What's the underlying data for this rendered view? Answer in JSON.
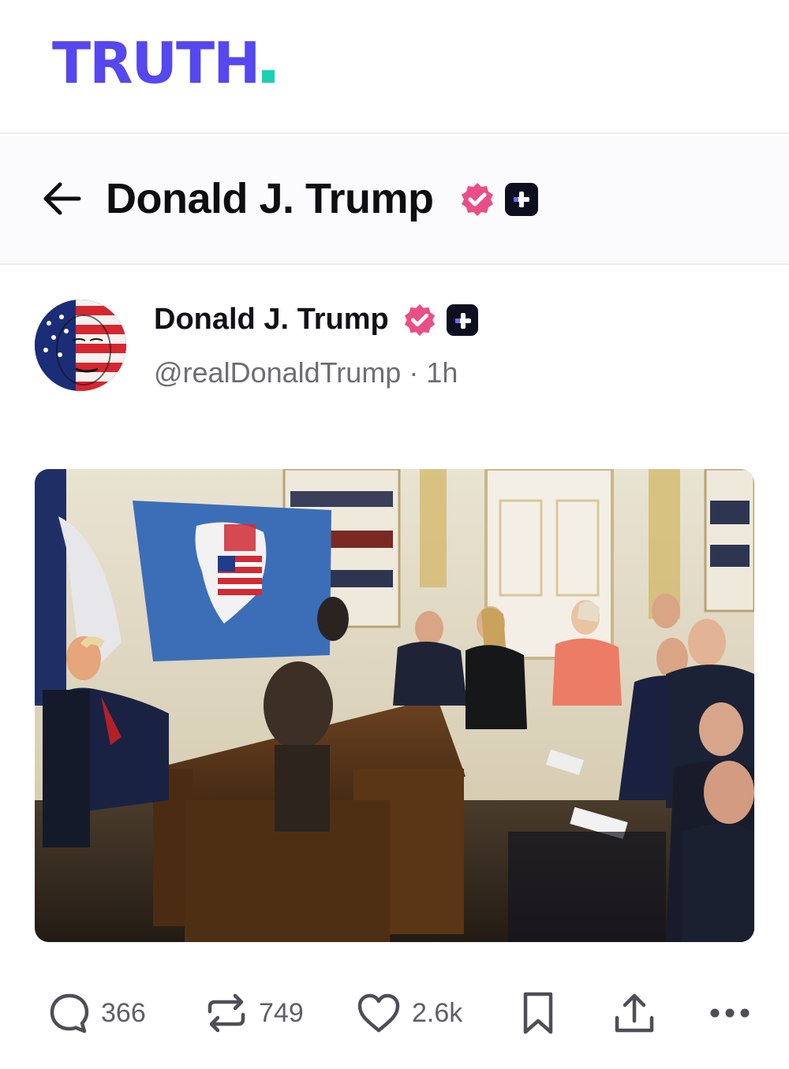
{
  "brand": {
    "logo_text": "TRUTH",
    "logo_color": "#5448ee",
    "logo_dot_color": "#17d2b4"
  },
  "header": {
    "back_icon": "arrow-left-icon",
    "title": "Donald J. Trump"
  },
  "post": {
    "author_name": "Donald J. Trump",
    "handle_time": "@realDonaldTrump · 1h",
    "image_description_icon": "photo",
    "stats": {
      "replies": "366",
      "retruths": "749",
      "likes": "2.6k"
    }
  },
  "colors": {
    "verified_badge": "#e94f86",
    "plus_badge": "#0d0f1e",
    "muted_text": "#6d6d78"
  }
}
